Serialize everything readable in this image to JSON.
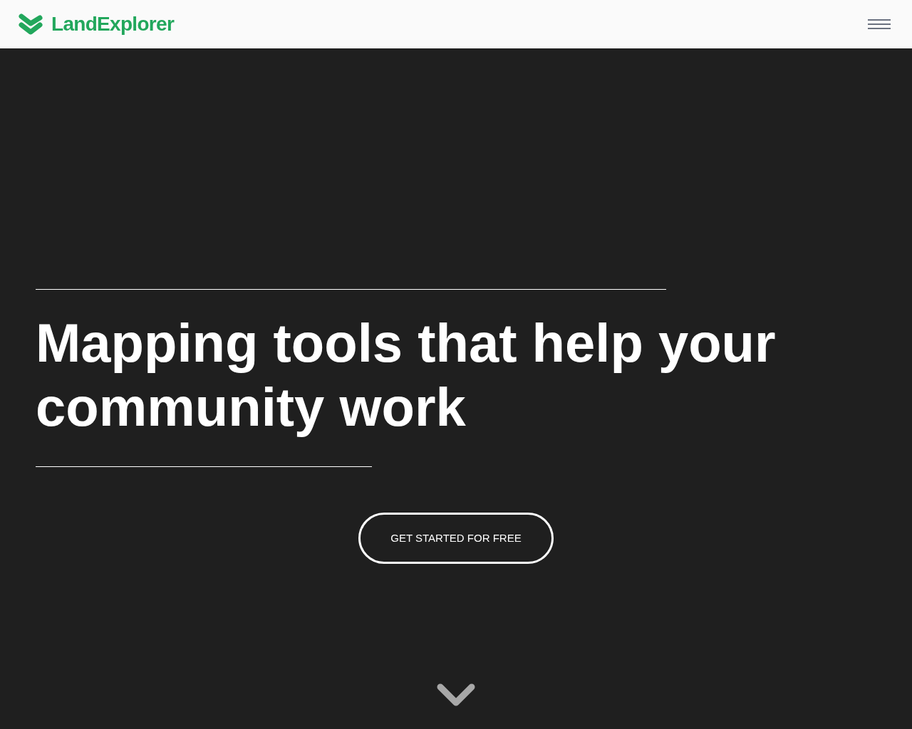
{
  "header": {
    "brand": "LandExplorer"
  },
  "hero": {
    "headline": "Mapping tools that help your community work",
    "cta": "GET STARTED FOR FREE"
  }
}
